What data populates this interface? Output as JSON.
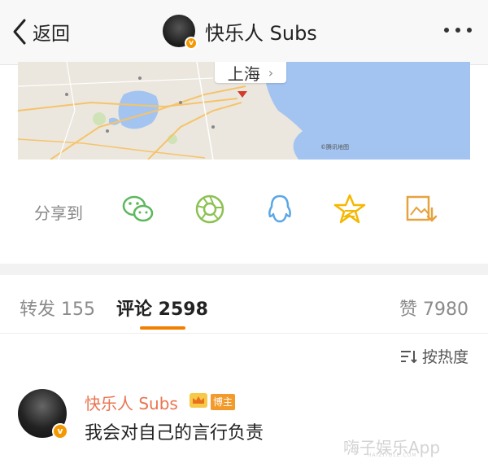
{
  "nav": {
    "back_label": "返回",
    "title": "快乐人 Subs",
    "verified_mark": "v"
  },
  "map": {
    "location_label": "上海",
    "chevron": "›",
    "copyright": "©腾讯地图"
  },
  "share": {
    "label": "分享到",
    "targets": [
      "wechat-icon",
      "moments-icon",
      "qq-icon",
      "qzone-icon",
      "save-image-icon"
    ]
  },
  "tabs": {
    "repost": "转发 155",
    "comment": "评论 2598",
    "like": "赞 7980"
  },
  "sort": {
    "label": "按热度"
  },
  "comment": {
    "author": "快乐人 Subs",
    "badge": "博主",
    "text": "我会对自己的言行负责",
    "verified_mark": "v"
  },
  "watermark": {
    "text": "嗨子娱乐App",
    "sub": "HAIZIYULE.COM"
  },
  "colors": {
    "accent_orange": "#f08000",
    "name_orange": "#eb7350",
    "share_green": "#5cb85c",
    "share_blue": "#5aa7e6",
    "share_yellow": "#f5b800"
  }
}
